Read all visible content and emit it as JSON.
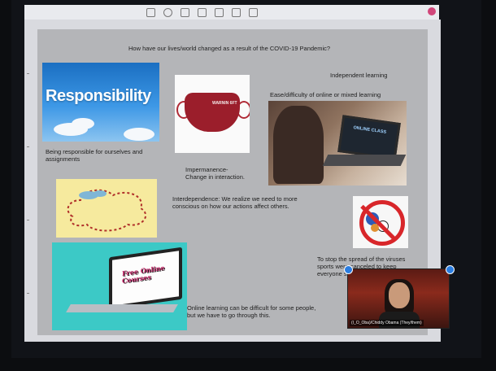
{
  "slide": {
    "title": "How have our lives/world changed as a result of the COVID-19 Pandemic?",
    "independent_learning": "Independent learning",
    "ease_difficulty": "Ease/difficulty of online or mixed learning",
    "responsibility_image_text": "Responsibility",
    "responsible_caption": "Being responsible for ourselves and assignments",
    "impermanence": "Impermanence- Change in interaction.",
    "interdependence": "Interdependence: We realize we need to more conscious on how our actions affect others.",
    "stop_spread": "To stop the spread of the viruses sports were canceled to keep everyone s",
    "online_difficult": "Online learning can be difficult for some people, but we have to go through this.",
    "mask_text": "WARNIN 6FT",
    "laptop_screen_text": "ONLINE CLASS",
    "free_online_text": "Free Online Courses"
  },
  "video": {
    "participant_name": "(I_O_Oba)/Chiddy Obama (They/them)"
  },
  "colors": {
    "slide_bg": "#b4b5b8",
    "toolbar_accent": "#d1467a",
    "selection_handle": "#2a7de1"
  }
}
